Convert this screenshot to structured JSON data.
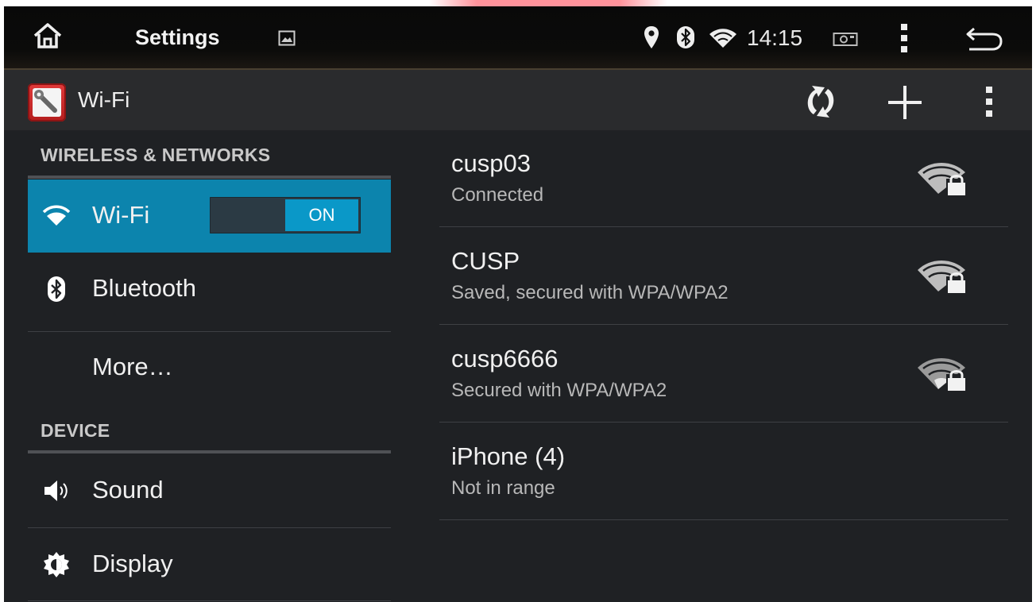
{
  "status_bar": {
    "title": "Settings",
    "time": "14:15",
    "icons": [
      "home-icon",
      "gallery-icon",
      "location-icon",
      "bluetooth-icon",
      "wifi-icon",
      "camera-icon",
      "overflow-menu-icon",
      "back-icon"
    ]
  },
  "action_bar": {
    "title": "Wi-Fi",
    "icons": [
      "settings-app-icon",
      "wps-icon",
      "add-network-icon",
      "overflow-menu-icon"
    ]
  },
  "sidebar": {
    "sections": [
      {
        "header": "WIRELESS & NETWORKS",
        "items": [
          {
            "label": "Wi-Fi",
            "icon": "wifi-icon",
            "selected": true,
            "toggle": "ON"
          },
          {
            "label": "Bluetooth",
            "icon": "bluetooth-icon"
          },
          {
            "label": "More…"
          }
        ]
      },
      {
        "header": "DEVICE",
        "items": [
          {
            "label": "Sound",
            "icon": "speaker-icon"
          },
          {
            "label": "Display",
            "icon": "brightness-icon"
          }
        ]
      }
    ]
  },
  "networks": [
    {
      "ssid": "cusp03",
      "status": "Connected",
      "icon": "wifi-locked-icon"
    },
    {
      "ssid": "CUSP",
      "status": "Saved, secured with WPA/WPA2",
      "icon": "wifi-locked-icon"
    },
    {
      "ssid": "cusp6666",
      "status": "Secured with WPA/WPA2",
      "icon": "wifi-locked-icon"
    },
    {
      "ssid": "iPhone (4)",
      "status": "Not in range"
    }
  ],
  "colors": {
    "accent": "#0c84ad",
    "toggle_on": "#0a98c8",
    "background": "#1f2124",
    "action_bar": "#2a2b2d"
  }
}
